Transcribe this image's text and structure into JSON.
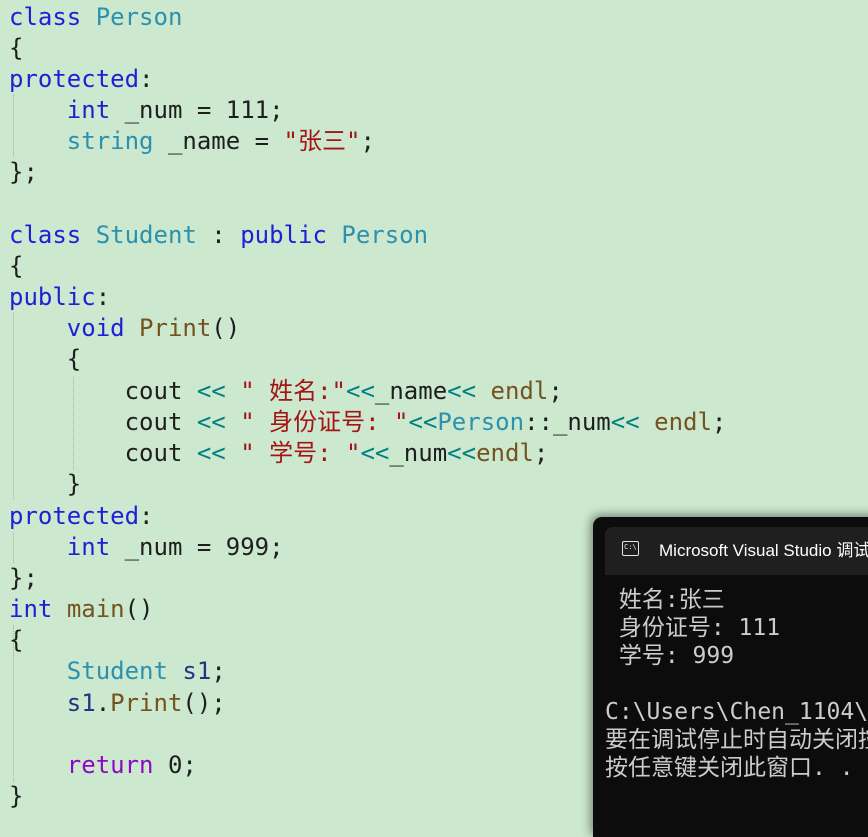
{
  "editor": {
    "lines": [
      {
        "tokens": [
          {
            "t": "class",
            "c": "kw"
          },
          {
            "t": " "
          },
          {
            "t": "Person",
            "c": "ty"
          }
        ]
      },
      {
        "tokens": [
          {
            "t": "{"
          }
        ]
      },
      {
        "tokens": [
          {
            "t": "protected",
            "c": "kw"
          },
          {
            "t": ":"
          }
        ]
      },
      {
        "tokens": [
          {
            "t": "    "
          },
          {
            "t": "int",
            "c": "kw"
          },
          {
            "t": " _num = 111;"
          }
        ]
      },
      {
        "tokens": [
          {
            "t": "    "
          },
          {
            "t": "string",
            "c": "ty"
          },
          {
            "t": " _name = "
          },
          {
            "t": "\"张三\"",
            "c": "str"
          },
          {
            "t": ";"
          }
        ]
      },
      {
        "tokens": [
          {
            "t": "};"
          }
        ]
      },
      {
        "tokens": []
      },
      {
        "tokens": [
          {
            "t": "class",
            "c": "kw"
          },
          {
            "t": " "
          },
          {
            "t": "Student",
            "c": "ty"
          },
          {
            "t": " : "
          },
          {
            "t": "public",
            "c": "kw"
          },
          {
            "t": " "
          },
          {
            "t": "Person",
            "c": "ty"
          }
        ]
      },
      {
        "tokens": [
          {
            "t": "{"
          }
        ]
      },
      {
        "tokens": [
          {
            "t": "public",
            "c": "kw"
          },
          {
            "t": ":"
          }
        ]
      },
      {
        "tokens": [
          {
            "t": "    "
          },
          {
            "t": "void",
            "c": "kw"
          },
          {
            "t": " "
          },
          {
            "t": "Print",
            "c": "fn"
          },
          {
            "t": "()"
          }
        ]
      },
      {
        "tokens": [
          {
            "t": "    {"
          }
        ]
      },
      {
        "tokens": [
          {
            "t": "        cout "
          },
          {
            "t": "<<",
            "c": "op"
          },
          {
            "t": " "
          },
          {
            "t": "\" 姓名:\"",
            "c": "str"
          },
          {
            "t": "<<",
            "c": "op"
          },
          {
            "t": "_name"
          },
          {
            "t": "<<",
            "c": "op"
          },
          {
            "t": " "
          },
          {
            "t": "endl",
            "c": "fn"
          },
          {
            "t": ";"
          }
        ]
      },
      {
        "tokens": [
          {
            "t": "        cout "
          },
          {
            "t": "<<",
            "c": "op"
          },
          {
            "t": " "
          },
          {
            "t": "\" 身份证号: \"",
            "c": "str"
          },
          {
            "t": "<<",
            "c": "op"
          },
          {
            "t": "Person",
            "c": "ty"
          },
          {
            "t": "::_num"
          },
          {
            "t": "<<",
            "c": "op"
          },
          {
            "t": " "
          },
          {
            "t": "endl",
            "c": "fn"
          },
          {
            "t": ";"
          }
        ]
      },
      {
        "tokens": [
          {
            "t": "        cout "
          },
          {
            "t": "<<",
            "c": "op"
          },
          {
            "t": " "
          },
          {
            "t": "\" 学号: \"",
            "c": "str"
          },
          {
            "t": "<<",
            "c": "op"
          },
          {
            "t": "_num"
          },
          {
            "t": "<<",
            "c": "op"
          },
          {
            "t": "endl",
            "c": "fn"
          },
          {
            "t": ";"
          }
        ]
      },
      {
        "tokens": [
          {
            "t": "    }"
          }
        ]
      },
      {
        "tokens": [
          {
            "t": "protected",
            "c": "kw"
          },
          {
            "t": ":"
          }
        ]
      },
      {
        "tokens": [
          {
            "t": "    "
          },
          {
            "t": "int",
            "c": "kw"
          },
          {
            "t": " _num = 999;"
          }
        ]
      },
      {
        "tokens": [
          {
            "t": "};"
          }
        ]
      },
      {
        "tokens": [
          {
            "t": "int",
            "c": "kw"
          },
          {
            "t": " "
          },
          {
            "t": "main",
            "c": "fn"
          },
          {
            "t": "()"
          }
        ]
      },
      {
        "tokens": [
          {
            "t": "{"
          }
        ]
      },
      {
        "tokens": [
          {
            "t": "    "
          },
          {
            "t": "Student",
            "c": "ty"
          },
          {
            "t": " "
          },
          {
            "t": "s1",
            "c": "var"
          },
          {
            "t": ";"
          }
        ]
      },
      {
        "tokens": [
          {
            "t": "    "
          },
          {
            "t": "s1",
            "c": "var"
          },
          {
            "t": "."
          },
          {
            "t": "Print",
            "c": "fn"
          },
          {
            "t": "();"
          }
        ]
      },
      {
        "tokens": []
      },
      {
        "tokens": [
          {
            "t": "    "
          },
          {
            "t": "return",
            "c": "ctl"
          },
          {
            "t": " 0;"
          }
        ]
      },
      {
        "tokens": [
          {
            "t": "}"
          }
        ]
      }
    ]
  },
  "console": {
    "title": "Microsoft Visual Studio 调试控制台",
    "icon": "console-app-icon",
    "icon_text": "C:\\",
    "output_lines": [
      " 姓名:张三",
      " 身份证号: 111",
      " 学号: 999",
      "",
      "C:\\Users\\Chen_1104\\",
      "要在调试停止时自动关闭控制台",
      "按任意键关闭此窗口. . ."
    ]
  }
}
